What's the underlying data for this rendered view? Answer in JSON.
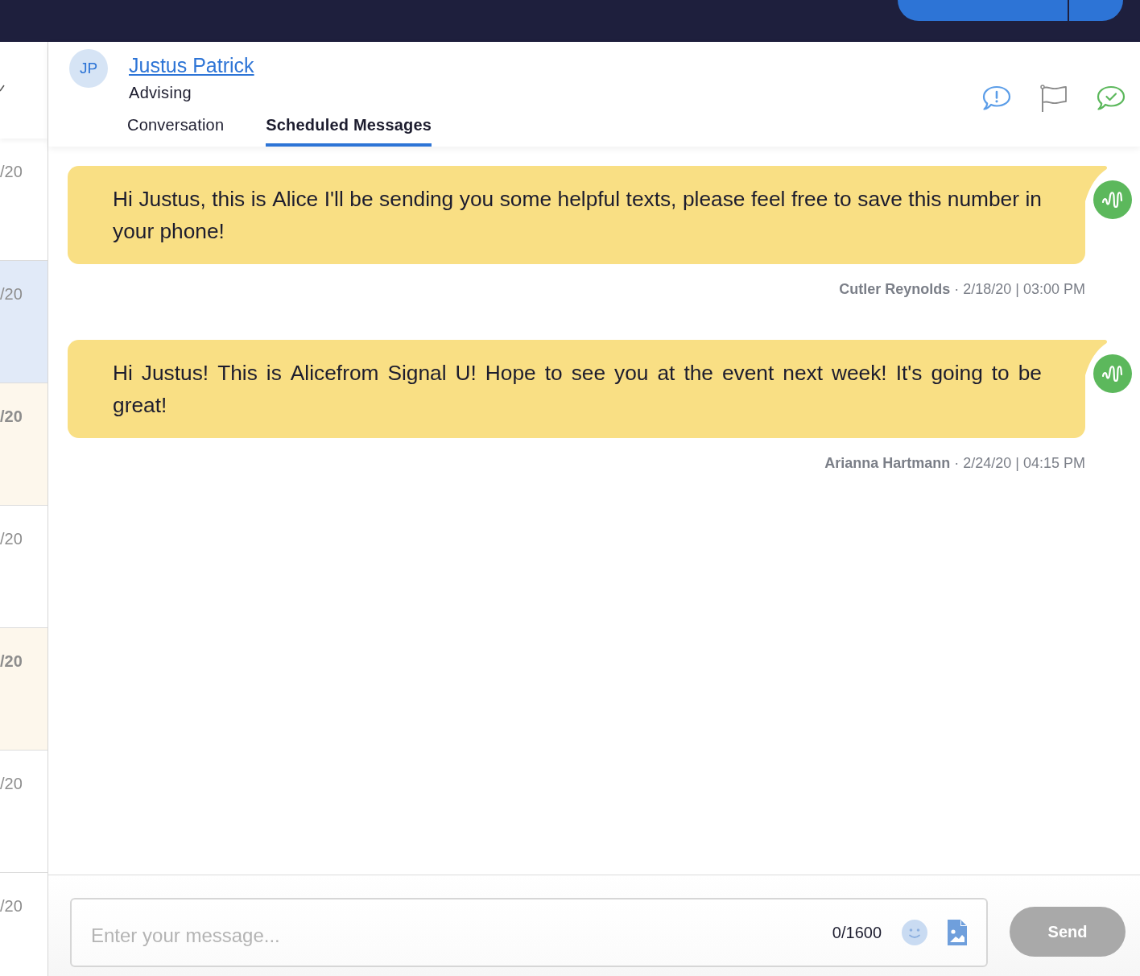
{
  "conversation_list": [
    {
      "date": "/20",
      "selected": false,
      "unread": false
    },
    {
      "date": "/20",
      "selected": true,
      "unread": false
    },
    {
      "date": "/20",
      "selected": false,
      "unread": true
    },
    {
      "date": "/20",
      "selected": false,
      "unread": false
    },
    {
      "date": "/20",
      "selected": false,
      "unread": true
    },
    {
      "date": "/20",
      "selected": false,
      "unread": false
    },
    {
      "date": "/20",
      "selected": false,
      "unread": false
    }
  ],
  "contact": {
    "initials": "JP",
    "name": "Justus Patrick",
    "group": "Advising"
  },
  "tabs": [
    {
      "label": "Conversation",
      "selected": false
    },
    {
      "label": "Scheduled Messages",
      "selected": true
    }
  ],
  "messages": [
    {
      "text": "Hi Justus, this is Alice I'll be sending you some helpful texts, please feel free to save this number in your phone!",
      "meta": "**Cutler Reynolds** · 2/18/20 | 03:00 PM"
    },
    {
      "text": "Hi Justus! This is Alicefrom Signal U! Hope to see you at the event next week! It's going to be great!",
      "meta": "**Arianna Hartmann** · 2/24/20 | 04:15 PM"
    }
  ],
  "composer": {
    "placeholder": "Enter your message...",
    "counter": "0/1600",
    "send": {
      "label": "Send",
      "disabled": true
    }
  }
}
